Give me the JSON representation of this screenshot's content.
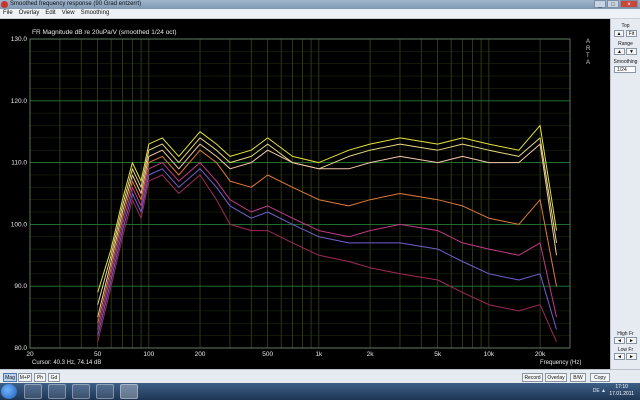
{
  "window": {
    "title": "Smoothed frequency response (90 Grad entzerrt)",
    "min_label": "_",
    "max_label": "□",
    "close_label": "×"
  },
  "menu": [
    "File",
    "Overlay",
    "Edit",
    "View",
    "Smoothing"
  ],
  "side_panel": {
    "top_label": "Top",
    "top_up": "▲",
    "fit_label": "Fit",
    "range_label": "Range",
    "range_up": "▲",
    "range_down": "▼",
    "smoothing_label": "Smoothing",
    "smoothing_value": "1/24",
    "high_fr_label": "High Fr",
    "low_fr_label": "Low Fr",
    "arrow_left": "◄",
    "arrow_right": "►"
  },
  "bottom_buttons": {
    "mag": "Mag",
    "m_p": "M+P",
    "ph": "Ph",
    "gd": "Gd",
    "record": "Record",
    "overlay": "Overlay",
    "bw": "B/W",
    "copy": "Copy"
  },
  "taskbar": {
    "clock_time": "17:10",
    "clock_date": "17.01.2011",
    "tray": "DE ▲"
  },
  "chart_data": {
    "type": "line",
    "title": "FR Magnitude dB re 20uPa/V (smoothed 1/24 oct)",
    "watermark": "ARTA",
    "xlabel": "Frequency (Hz)",
    "cursor_readout": "Cursor: 40.3 Hz, 74.14 dB",
    "x_scale": "log",
    "xlim": [
      20,
      30000
    ],
    "ylim": [
      80,
      130
    ],
    "grid": true,
    "x_ticks": [
      {
        "v": 20,
        "label": "20"
      },
      {
        "v": 50,
        "label": "50"
      },
      {
        "v": 100,
        "label": "100"
      },
      {
        "v": 200,
        "label": "200"
      },
      {
        "v": 500,
        "label": "500"
      },
      {
        "v": 1000,
        "label": "1k"
      },
      {
        "v": 2000,
        "label": "2k"
      },
      {
        "v": 5000,
        "label": "5k"
      },
      {
        "v": 10000,
        "label": "10k"
      },
      {
        "v": 20000,
        "label": "20k"
      }
    ],
    "y_ticks": [
      {
        "v": 80,
        "label": "80.0"
      },
      {
        "v": 90,
        "label": "90.0"
      },
      {
        "v": 100,
        "label": "100.0"
      },
      {
        "v": 110,
        "label": "110.0"
      },
      {
        "v": 120,
        "label": "120.0"
      },
      {
        "v": 130,
        "label": "130.0"
      }
    ],
    "x": [
      50,
      60,
      70,
      80,
      90,
      100,
      120,
      150,
      200,
      250,
      300,
      400,
      500,
      700,
      1000,
      1500,
      2000,
      3000,
      5000,
      7000,
      10000,
      15000,
      20000,
      25000
    ],
    "series": [
      {
        "color": "#e4e23a",
        "values": [
          89,
          96,
          104,
          110,
          107,
          113,
          114,
          111,
          115,
          113,
          111,
          112,
          114,
          111,
          110,
          112,
          113,
          114,
          113,
          114,
          113,
          112,
          116,
          99
        ]
      },
      {
        "color": "#e8d880",
        "values": [
          87,
          95,
          103,
          109,
          106,
          112,
          113,
          110,
          114,
          112,
          110,
          111,
          113,
          110,
          109,
          111,
          112,
          113,
          112,
          113,
          112,
          111,
          114,
          97
        ]
      },
      {
        "color": "#f2c8a8",
        "values": [
          85,
          94,
          102,
          108,
          105,
          111,
          112,
          109,
          113,
          111,
          109,
          110,
          112,
          110,
          109,
          109,
          110,
          111,
          110,
          111,
          110,
          110,
          113,
          95
        ]
      },
      {
        "color": "#e07a3a",
        "values": [
          84,
          93,
          101,
          107,
          104,
          110,
          111,
          108,
          112,
          110,
          107,
          106,
          108,
          106,
          104,
          103,
          104,
          105,
          104,
          103,
          101,
          100,
          104,
          90
        ]
      },
      {
        "color": "#c03a8a",
        "values": [
          83,
          92,
          100,
          106,
          103,
          109,
          110,
          107,
          110,
          107,
          104,
          102,
          103,
          101,
          99,
          98,
          99,
          100,
          99,
          97,
          96,
          95,
          97,
          85
        ]
      },
      {
        "color": "#7060d0",
        "values": [
          82,
          91,
          99,
          105,
          102,
          108,
          109,
          106,
          109,
          106,
          103,
          101,
          102,
          100,
          98,
          97,
          97,
          97,
          96,
          94,
          92,
          91,
          92,
          83
        ]
      },
      {
        "color": "#a02a5a",
        "values": [
          81,
          90,
          98,
          104,
          101,
          107,
          108,
          105,
          108,
          104,
          100,
          99,
          99,
          97,
          95,
          94,
          93,
          92,
          91,
          89,
          87,
          86,
          87,
          81
        ]
      }
    ]
  }
}
